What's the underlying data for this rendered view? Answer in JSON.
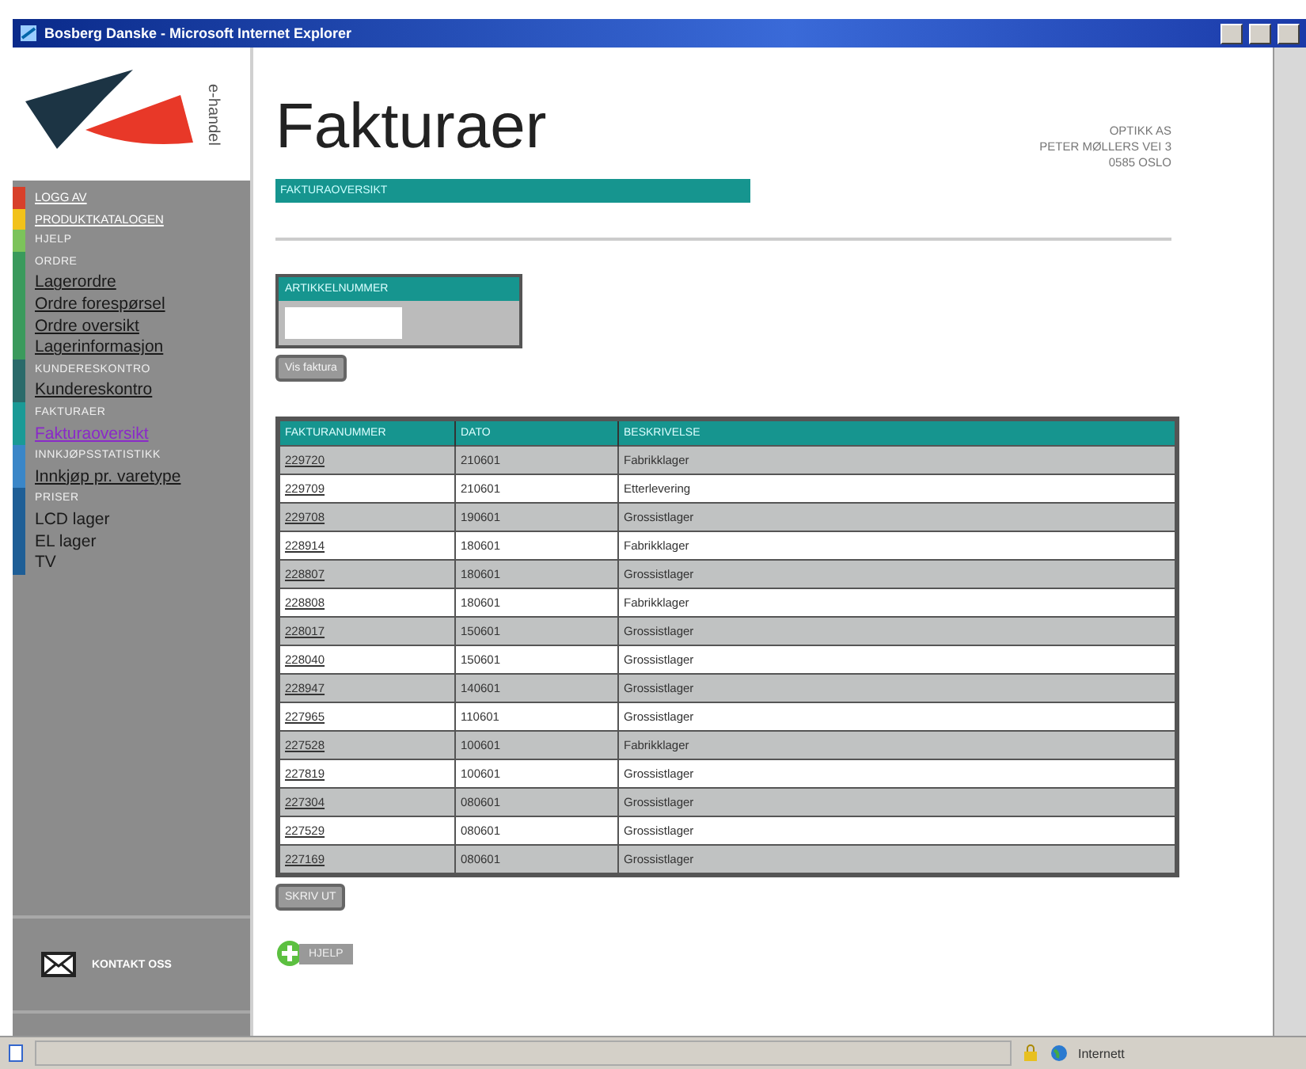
{
  "window": {
    "title": "Bosberg Danske - Microsoft Internet Explorer"
  },
  "logo": {
    "text": "e-handel"
  },
  "sidebar": {
    "sections": [
      {
        "color": "#d8402a",
        "items": [
          {
            "kind": "link",
            "label": "LOGG AV",
            "selected": false
          }
        ]
      },
      {
        "color": "#f2c21a",
        "items": [
          {
            "kind": "link",
            "label": "PRODUKTKATALOGEN",
            "selected": false
          }
        ]
      },
      {
        "color": "#7cc35a",
        "items": [
          {
            "kind": "heading",
            "label": "HJELP"
          }
        ]
      },
      {
        "color": "#3a9a5c",
        "items": [
          {
            "kind": "heading",
            "label": "ORDRE"
          },
          {
            "kind": "link",
            "label": "Lagerordre",
            "selected": false
          },
          {
            "kind": "link",
            "label": "Ordre forespørsel",
            "selected": false
          },
          {
            "kind": "link",
            "label": "Ordre oversikt",
            "selected": false
          },
          {
            "kind": "link",
            "label": "Lagerinformasjon",
            "selected": false
          }
        ]
      },
      {
        "color": "#2a6a6a",
        "items": [
          {
            "kind": "heading",
            "label": "KUNDERESKONTRO"
          },
          {
            "kind": "link",
            "label": "Kundereskontro",
            "selected": false
          }
        ]
      },
      {
        "color": "#1a9a96",
        "items": [
          {
            "kind": "heading",
            "label": "FAKTURAER"
          },
          {
            "kind": "link",
            "label": "Fakturaoversikt",
            "selected": true
          }
        ]
      },
      {
        "color": "#3a86c8",
        "items": [
          {
            "kind": "heading",
            "label": "INNKJØPSSTATISTIKK"
          },
          {
            "kind": "link",
            "label": "Innkjøp pr. varetype",
            "selected": false
          }
        ]
      },
      {
        "color": "#1e5e96",
        "items": [
          {
            "kind": "heading",
            "label": "PRISER"
          },
          {
            "kind": "text",
            "label": "LCD lager"
          },
          {
            "kind": "text",
            "label": "EL lager"
          },
          {
            "kind": "text",
            "label": "TV"
          }
        ]
      }
    ],
    "contact": "KONTAKT OSS"
  },
  "page": {
    "title": "Fakturaer",
    "subtitle": "FAKTURAOVERSIKT",
    "address": [
      "OPTIKK AS",
      "PETER MØLLERS VEI 3",
      "0585 OSLO"
    ]
  },
  "search": {
    "label": "ARTIKKELNUMMER",
    "button": "Vis faktura"
  },
  "table": {
    "columns": [
      "FAKTURANUMMER",
      "DATO",
      "BESKRIVELSE"
    ],
    "rows": [
      [
        "229720",
        "210601",
        "Fabrikklager"
      ],
      [
        "229709",
        "210601",
        "Etterlevering"
      ],
      [
        "229708",
        "190601",
        "Grossistlager"
      ],
      [
        "228914",
        "180601",
        "Fabrikklager"
      ],
      [
        "228807",
        "180601",
        "Grossistlager"
      ],
      [
        "228808",
        "180601",
        "Fabrikklager"
      ],
      [
        "228017",
        "150601",
        "Grossistlager"
      ],
      [
        "228040",
        "150601",
        "Grossistlager"
      ],
      [
        "228947",
        "140601",
        "Grossistlager"
      ],
      [
        "227965",
        "110601",
        "Grossistlager"
      ],
      [
        "227528",
        "100601",
        "Fabrikklager"
      ],
      [
        "227819",
        "100601",
        "Grossistlager"
      ],
      [
        "227304",
        "080601",
        "Grossistlager"
      ],
      [
        "227529",
        "080601",
        "Grossistlager"
      ],
      [
        "227169",
        "080601",
        "Grossistlager"
      ]
    ]
  },
  "print_button": "SKRIV UT",
  "help_button": "HJELP",
  "status_bar": {
    "zone": "Internett"
  }
}
